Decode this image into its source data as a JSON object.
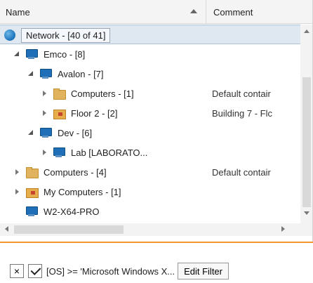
{
  "columns": {
    "name": "Name",
    "comment": "Comment"
  },
  "tree": [
    {
      "label": "Network - [40 of 41]",
      "comment": "",
      "icon": "globe-icon",
      "expander": "none",
      "selected": true
    },
    {
      "label": "Emco - [8]",
      "comment": "",
      "icon": "computer-group-icon",
      "expander": "open"
    },
    {
      "label": "Avalon - [7]",
      "comment": "",
      "icon": "computer-group-icon",
      "expander": "open"
    },
    {
      "label": "Computers - [1]",
      "comment": "Default contair",
      "icon": "folder-icon",
      "expander": "closed"
    },
    {
      "label": "Floor 2 - [2]",
      "comment": "Building 7 - Flc",
      "icon": "organizational-unit-icon",
      "expander": "closed"
    },
    {
      "label": "Dev - [6]",
      "comment": "",
      "icon": "computer-group-icon",
      "expander": "open"
    },
    {
      "label": "Lab [LABORATO...",
      "comment": "",
      "icon": "computer-group-icon",
      "expander": "closed"
    },
    {
      "label": "Computers - [4]",
      "comment": "Default contair",
      "icon": "folder-icon",
      "expander": "closed"
    },
    {
      "label": "My Computers - [1]",
      "comment": "",
      "icon": "organizational-unit-icon",
      "expander": "closed"
    },
    {
      "label": "W2-X64-PRO",
      "comment": "",
      "icon": "computer-icon",
      "expander": "none"
    }
  ],
  "filter": {
    "remove_label": "×",
    "enabled": true,
    "text": "[OS] >= 'Microsoft Windows X...",
    "edit_button": "Edit Filter"
  }
}
